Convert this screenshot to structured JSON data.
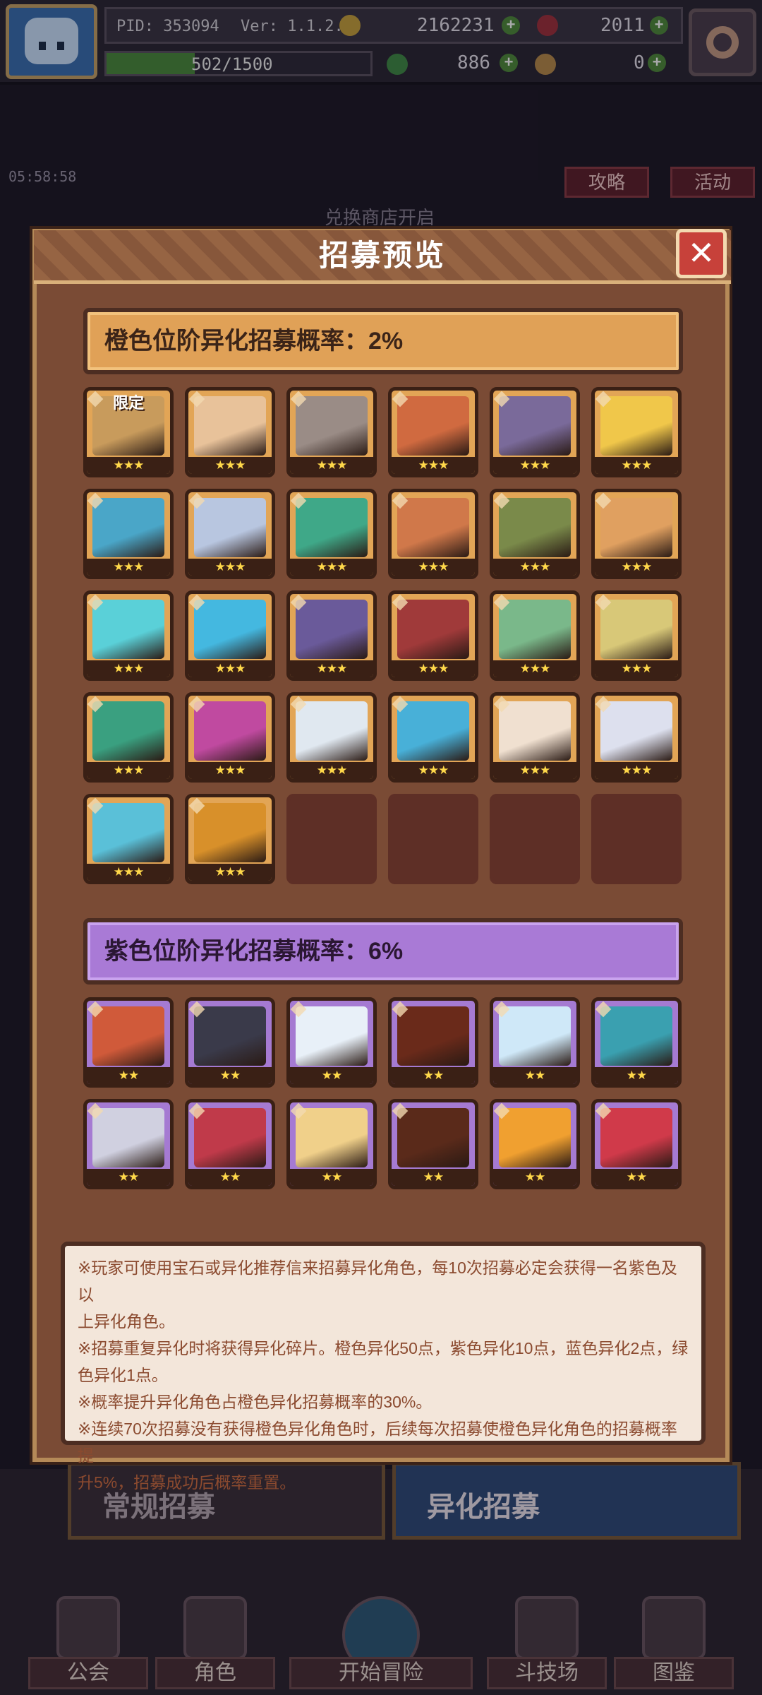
{
  "hud": {
    "pid": "PID: 353094",
    "version": "Ver: 1.1.2.5",
    "gold": "2162231",
    "gems": "2011",
    "exp": "502/1500",
    "exp_fraction": 0.335,
    "clover": "886",
    "hand": "0"
  },
  "side": {
    "timer": "05:58:58",
    "guide_label": "攻略",
    "event_label": "活动",
    "shop_banner": "兑换商店开启"
  },
  "modal": {
    "title": "招募预览",
    "orange_rate": "橙色位阶异化招募概率：2%",
    "purple_rate": "紫色位阶异化招募概率：6%",
    "limited_tag": "限定",
    "orange_stars": "★★★",
    "purple_stars": "★★",
    "orange_colors": [
      "#c89b5c",
      "#e8c29a",
      "#9a8c86",
      "#d06a40",
      "#7a6a9a",
      "#f0c74a",
      "#4aa6c8",
      "#b8c6e0",
      "#3fa888",
      "#d0784a",
      "#7a8a4a",
      "#e0a060",
      "#5ad0d8",
      "#44b8e0",
      "#6a5a9a",
      "#a03a3a",
      "#7ab88a",
      "#d8c878",
      "#3aa080",
      "#c04aa0",
      "#e0e8f0",
      "#48b0d8",
      "#f0e0d0",
      "#dde0ee",
      "#5ac0d8",
      "#d8902a"
    ],
    "purple_colors": [
      "#d05a3a",
      "#3a3a4a",
      "#e8f0f8",
      "#6a2a1a",
      "#cfe8f8",
      "#3aa0b0",
      "#d0d0e0",
      "#c03a4a",
      "#f0d08a",
      "#5a2a1a",
      "#f0a030",
      "#d03a4a"
    ],
    "notes": [
      "※玩家可使用宝石或异化推荐信来招募异化角色，每10次招募必定会获得一名紫色及以",
      "上异化角色。",
      "※招募重复异化时将获得异化碎片。橙色异化50点，紫色异化10点，蓝色异化2点，绿",
      "色异化1点。",
      "※概率提升异化角色占橙色异化招募概率的30%。",
      "※连续70次招募没有获得橙色异化角色时，后续每次招募使橙色异化角色的招募概率提",
      "升5%，招募成功后概率重置。"
    ]
  },
  "tabs": {
    "normal": "常规招募",
    "alien": "异化招募"
  },
  "nav": {
    "guild": "公会",
    "character": "角色",
    "adventure": "开始冒险",
    "arena": "斗技场",
    "codex": "图鉴"
  }
}
